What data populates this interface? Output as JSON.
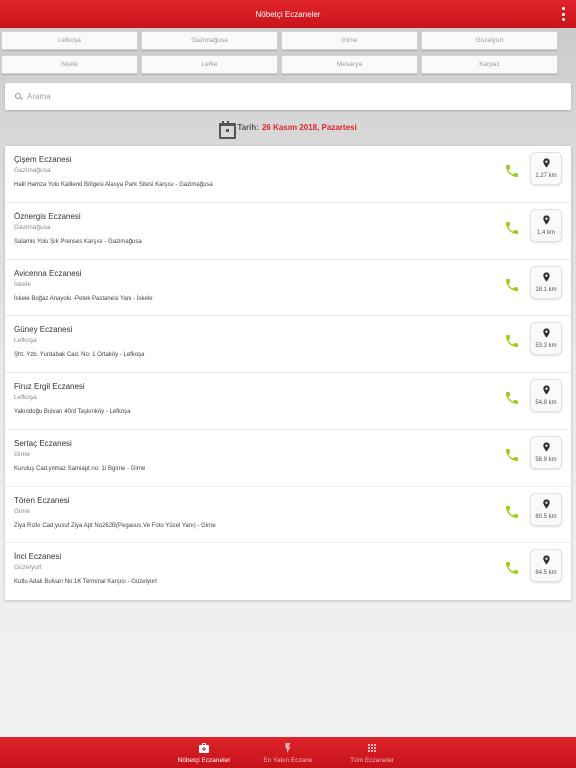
{
  "header": {
    "title": "Nöbetçi Eczaneler"
  },
  "regions": [
    "Lefkoşa",
    "Gazimağusa",
    "Girne",
    "Güzelyurt",
    "İskele",
    "Lefke",
    "Mesarya",
    "Karpaz"
  ],
  "search": {
    "placeholder": "Arama"
  },
  "date": {
    "label": "Tarih:",
    "value": "26 Kasım 2018, Pazartesi"
  },
  "colors": {
    "brand": "#e0242b",
    "phone": "#9ccc1c"
  },
  "pharmacies": [
    {
      "name": "Çişem Eczanesi",
      "city": "Gazimağusa",
      "address": "Halil Hamza Yolu Kalilend Bölgesi Alasya Park Sitesi Karşısı - Gazimağusa",
      "distance": "1.27 km"
    },
    {
      "name": "Öznergis Eczanesi",
      "city": "Gazimağusa",
      "address": "Salamis Yolu Şık Prenses Karşısı - Gazimağusa",
      "distance": "1.4 km"
    },
    {
      "name": "Avicenna Eczanesi",
      "city": "İskele",
      "address": "İskele Boğaz Anayolu -Petek Pastanesi Yani - İskele",
      "distance": "18.1 km"
    },
    {
      "name": "Güney Eczanesi",
      "city": "Lefkoşa",
      "address": "Şht. Yzb. Yurdabak Cad. No: 1 Ortaköy - Lefkoşa",
      "distance": "53.3 km"
    },
    {
      "name": "Firuz Ergil Eczanesi",
      "city": "Lefkoşa",
      "address": "Yakındoğu Bulvarı 40/d Taşkınköy - Lefkoşa",
      "distance": "54.9 km"
    },
    {
      "name": "Sertaç Eczanesi",
      "city": "Girne",
      "address": "Kuruluş Cad.yılmaz Samiapt.no: 1/ Bgirne - Girne",
      "distance": "58.9 km"
    },
    {
      "name": "Tören Eczanesi",
      "city": "Girne",
      "address": "Ziya Rızkı Cad;yusuf Ziya Apt No262B(Pegasus Ve Foto Yücel Yanı) - Girne",
      "distance": "60.5 km"
    },
    {
      "name": "İnci Eczanesi",
      "city": "Güzelyurt",
      "address": "Kutlu Adalı Bulvarı No:1K Terminal Karşısı - Güzelyurt",
      "distance": "84.5 km"
    }
  ],
  "bottom_nav": [
    {
      "label": "Nöbetçi Eczaneler",
      "icon": "medical-kit-icon"
    },
    {
      "label": "En Yakın Eczane",
      "icon": "lightning-icon"
    },
    {
      "label": "Tüm Eczaneler",
      "icon": "grid-icon"
    }
  ]
}
